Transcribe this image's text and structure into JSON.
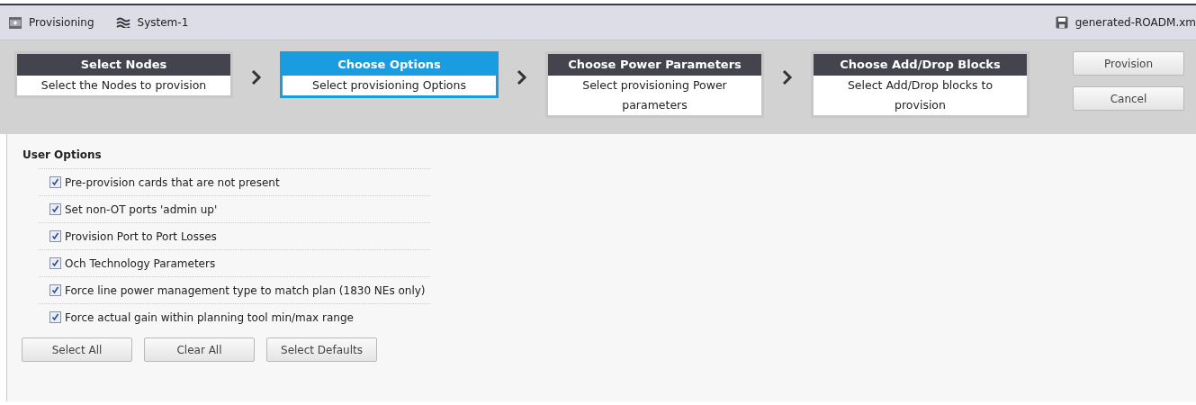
{
  "toolbar": {
    "tabs": [
      {
        "kind": "provisioning",
        "label": "Provisioning"
      },
      {
        "kind": "system",
        "label": "System-1"
      }
    ],
    "file": "generated-ROADM.xm"
  },
  "wizard": {
    "steps": [
      {
        "title": "Select Nodes",
        "description": "Select the Nodes to provision",
        "selected": false
      },
      {
        "title": "Choose Options",
        "description": "Select provisioning Options",
        "selected": true
      },
      {
        "title": "Choose Power Parameters",
        "description": "Select provisioning Power parameters",
        "selected": false
      },
      {
        "title": "Choose Add/Drop Blocks",
        "description": "Select Add/Drop blocks to provision",
        "selected": false
      }
    ],
    "buttons": [
      "Provision",
      "Cancel"
    ]
  },
  "user_options": {
    "title": "User Options",
    "options": [
      {
        "label": "Pre-provision cards that are not present",
        "checked": true
      },
      {
        "label": "Set non-OT ports 'admin up'",
        "checked": true
      },
      {
        "label": "Provision Port to Port Losses",
        "checked": true
      },
      {
        "label": "Och Technology Parameters",
        "checked": true
      },
      {
        "label": "Force line power management type to match plan (1830 NEs only)",
        "checked": true
      },
      {
        "label": "Force actual gain within planning tool min/max range",
        "checked": true
      }
    ],
    "buttons": [
      "Select All",
      "Clear All",
      "Select Defaults"
    ]
  }
}
